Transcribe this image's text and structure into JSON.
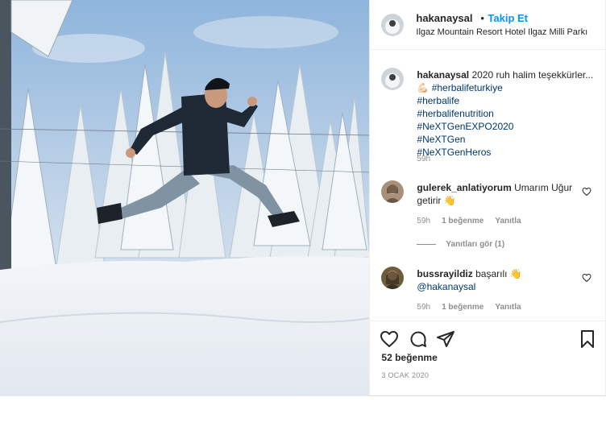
{
  "post": {
    "username": "hakanaysal",
    "separator": "•",
    "follow_label": "Takip Et",
    "location": "Ilgaz Mountain Resort Hotel Ilgaz Milli Parkı"
  },
  "caption": {
    "username": "hakanaysal",
    "text": "2020 ruh halim teşekkürler...💪🏻",
    "hashtags": [
      "#herbalifeturkiye",
      "#herbalife",
      "#herbalifenutrition",
      "#NeXTGenEXPO2020",
      "#NeXTGen",
      "#NeXTGenHeros"
    ],
    "time": "59h"
  },
  "comments": [
    {
      "username": "gulerek_anlatiyorum",
      "text": "Umarım Uğur getirir 👋",
      "time": "59h",
      "likes": "1 beğenme",
      "reply_label": "Yanıtla",
      "view_replies": "Yanıtları gör (1)"
    },
    {
      "username": "bussrayildiz",
      "text": "başarılı 👋",
      "mention": "@hakanaysal",
      "time": "59h",
      "likes": "1 beğenme",
      "reply_label": "Yanıtla"
    }
  ],
  "actions": {
    "icons": [
      "heart-icon",
      "comment-icon",
      "share-icon",
      "bookmark-icon"
    ],
    "likes_count": "52 beğenme",
    "date": "3 OCAK 2020"
  },
  "colors": {
    "link_blue": "#0095f6",
    "hashtag_blue": "#00376b",
    "muted_gray": "#8e8e8e",
    "text": "#262626"
  }
}
